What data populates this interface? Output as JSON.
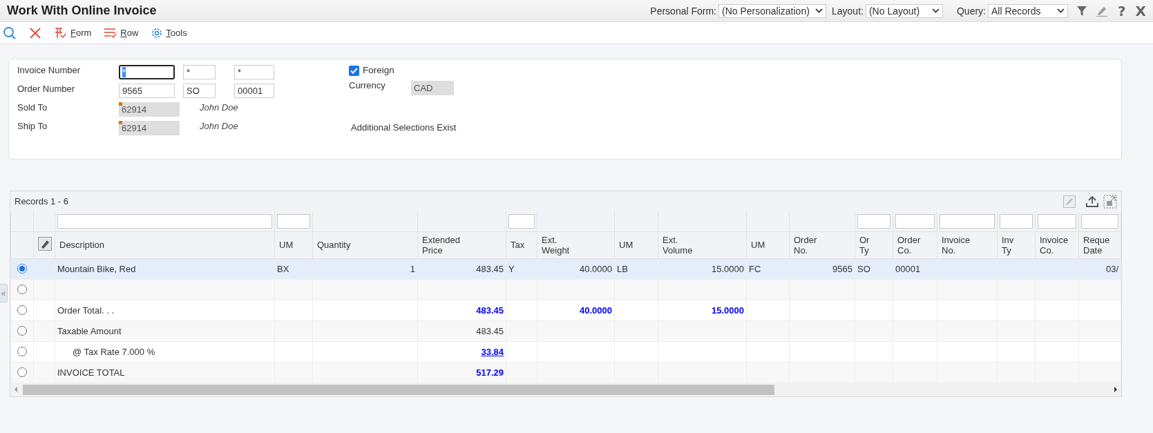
{
  "window": {
    "title": "Work With Online Invoice"
  },
  "header_controls": [
    {
      "label": "Personal Form:",
      "value": "(No Personalization)"
    },
    {
      "label": "Layout:",
      "value": "(No Layout)"
    },
    {
      "label": "Query:",
      "value": "All Records"
    }
  ],
  "header_glyphs": {
    "help": "?",
    "close": "X"
  },
  "toolbar": [
    {
      "kind": "search"
    },
    {
      "kind": "cancel"
    },
    {
      "kind": "form",
      "label": "Form"
    },
    {
      "kind": "row",
      "label": "Row"
    },
    {
      "kind": "tools",
      "label": "Tools"
    }
  ],
  "form": {
    "rows": [
      {
        "label": "Invoice Number",
        "fields": [
          {
            "value": "*",
            "focused": true
          },
          {
            "value": "*",
            "focused": false
          },
          {
            "value": "*",
            "focused": false
          }
        ]
      },
      {
        "label": "Order Number",
        "fields": [
          {
            "value": "9565",
            "focused": false
          },
          {
            "value": "SO",
            "focused": false
          },
          {
            "value": "00001",
            "focused": false
          }
        ]
      },
      {
        "label": "Sold To",
        "readonly_value": "62914",
        "name": "John Doe"
      },
      {
        "label": "Ship To",
        "readonly_value": "62914",
        "name": "John Doe"
      }
    ],
    "foreign": {
      "label": "Foreign",
      "checked": true
    },
    "currency": {
      "label": "Currency",
      "value": "CAD"
    },
    "note": "Additional Selections Exist"
  },
  "collapse_glyph": "«",
  "grid": {
    "records": "Records 1 - 6",
    "columns": [
      {
        "label": "Description",
        "filter": true,
        "numeric": false
      },
      {
        "label": "UM",
        "filter": true,
        "numeric": false
      },
      {
        "label": "Quantity",
        "filter": false,
        "numeric": true
      },
      {
        "label": "Extended\nPrice",
        "filter": false,
        "numeric": true
      },
      {
        "label": "Tax",
        "filter": true,
        "numeric": false
      },
      {
        "label": "Ext.\nWeight",
        "filter": false,
        "numeric": true
      },
      {
        "label": "UM",
        "filter": false,
        "numeric": false
      },
      {
        "label": "Ext.\nVolume",
        "filter": false,
        "numeric": true
      },
      {
        "label": "UM",
        "filter": false,
        "numeric": false
      },
      {
        "label": "Order\nNo.",
        "filter": false,
        "numeric": true
      },
      {
        "label": "Or\nTy",
        "filter": true,
        "numeric": false
      },
      {
        "label": "Order\nCo.",
        "filter": true,
        "numeric": false
      },
      {
        "label": "Invoice\nNo.",
        "filter": true
      },
      {
        "label": "Inv\nTy",
        "filter": true
      },
      {
        "label": "Invoice\nCo.",
        "filter": true
      },
      {
        "label": "Reque\nDate",
        "filter": true,
        "numeric": true
      }
    ],
    "rows": [
      {
        "selected": true,
        "cells": [
          {
            "text": "Mountain Bike, Red",
            "kind": "plain"
          },
          {
            "text": "BX",
            "kind": "plain"
          },
          {
            "text": "1",
            "kind": "plain"
          },
          {
            "text": "483.45",
            "kind": "plain"
          },
          {
            "text": "Y",
            "kind": "plain"
          },
          {
            "text": "40.0000",
            "kind": "plain"
          },
          {
            "text": "LB",
            "kind": "plain"
          },
          {
            "text": "15.0000",
            "kind": "plain"
          },
          {
            "text": "FC",
            "kind": "plain"
          },
          {
            "text": "9565",
            "kind": "plain"
          },
          {
            "text": "SO",
            "kind": "plain"
          },
          {
            "text": "00001",
            "kind": "plain"
          },
          null,
          null,
          null,
          {
            "text": "03/",
            "kind": "plain"
          }
        ]
      },
      {
        "selected": false
      },
      {
        "selected": false,
        "cells": [
          {
            "text": "Order Total. . .",
            "kind": "plain"
          },
          null,
          null,
          {
            "text": "483.45",
            "kind": "total"
          },
          null,
          {
            "text": "40.0000",
            "kind": "total"
          },
          null,
          {
            "text": "15.0000",
            "kind": "total"
          }
        ]
      },
      {
        "selected": false,
        "cells": [
          {
            "text": "Taxable Amount",
            "kind": "plain"
          },
          null,
          null,
          {
            "text": "483.45",
            "kind": "plain"
          }
        ]
      },
      {
        "selected": false,
        "cells": [
          {
            "text": "@ Tax Rate 7.000 %",
            "kind": "indent"
          },
          null,
          null,
          {
            "text": "33.84",
            "kind": "link"
          }
        ]
      },
      {
        "selected": false,
        "cells": [
          {
            "text": "INVOICE TOTAL",
            "kind": "plain"
          },
          null,
          null,
          {
            "text": "517.29",
            "kind": "total"
          }
        ]
      }
    ]
  }
}
